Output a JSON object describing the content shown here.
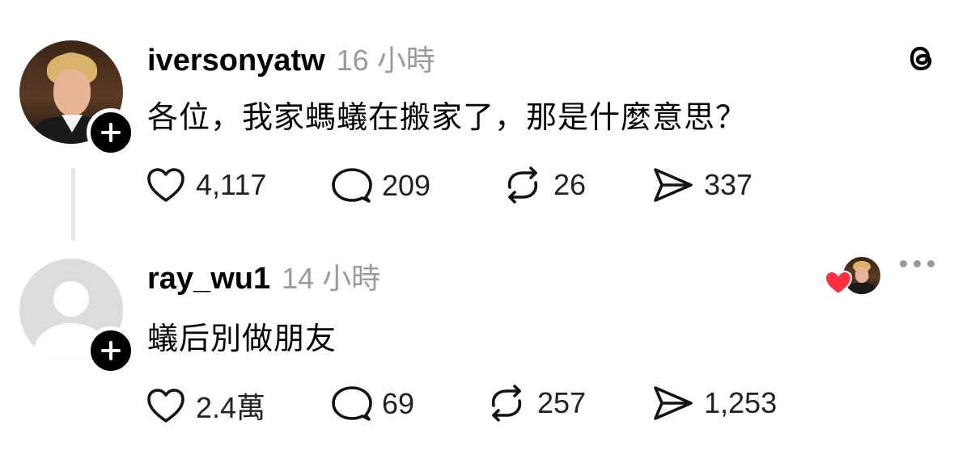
{
  "posts": [
    {
      "username": "iversonyatw",
      "time": "16 小時",
      "text": "各位，我家螞蟻在搬家了，那是什麼意思？",
      "likes": "4,117",
      "comments": "209",
      "reposts": "26",
      "shares": "337"
    },
    {
      "username": "ray_wu1",
      "time": "14 小時",
      "text": "蟻后別做朋友",
      "likes": "2.4萬",
      "comments": "69",
      "reposts": "257",
      "shares": "1,253"
    }
  ],
  "icons": {
    "app_logo": "threads-logo-icon",
    "like": "heart-icon",
    "comment": "comment-bubble-icon",
    "repost": "repost-icon",
    "share": "send-icon",
    "follow": "plus-icon",
    "more": "more-horizontal-icon"
  },
  "colors": {
    "text": "#000000",
    "muted": "#9a9a9a",
    "liked_heart": "#ff3040",
    "thread_line": "#e6e6e6"
  }
}
